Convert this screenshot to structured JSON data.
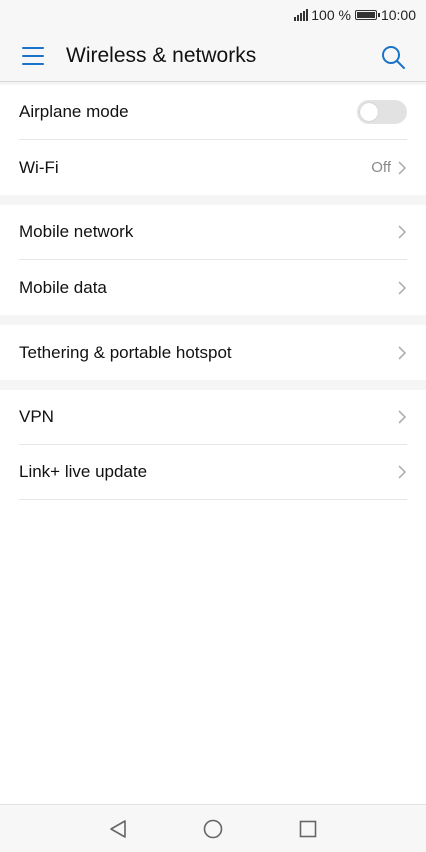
{
  "status_bar": {
    "battery": "100 %",
    "time": "10:00"
  },
  "header": {
    "title": "Wireless & networks"
  },
  "sections": [
    {
      "items": [
        {
          "label": "Airplane mode",
          "type": "toggle",
          "checked": false
        },
        {
          "label": "Wi-Fi",
          "type": "link",
          "value": "Off"
        }
      ]
    },
    {
      "items": [
        {
          "label": "Mobile network",
          "type": "link"
        },
        {
          "label": "Mobile data",
          "type": "link"
        }
      ]
    },
    {
      "items": [
        {
          "label": "Tethering & portable hotspot",
          "type": "link"
        }
      ]
    },
    {
      "items": [
        {
          "label": "VPN",
          "type": "link"
        },
        {
          "label": "Link+ live update",
          "type": "link"
        }
      ]
    }
  ],
  "colors": {
    "accent": "#1a73c9",
    "background": "#f5f5f5",
    "card": "#ffffff"
  },
  "icons": [
    "signal-icon",
    "battery-icon",
    "menu-icon",
    "search-icon",
    "chevron-right-icon",
    "back-icon",
    "home-icon",
    "recents-icon"
  ]
}
